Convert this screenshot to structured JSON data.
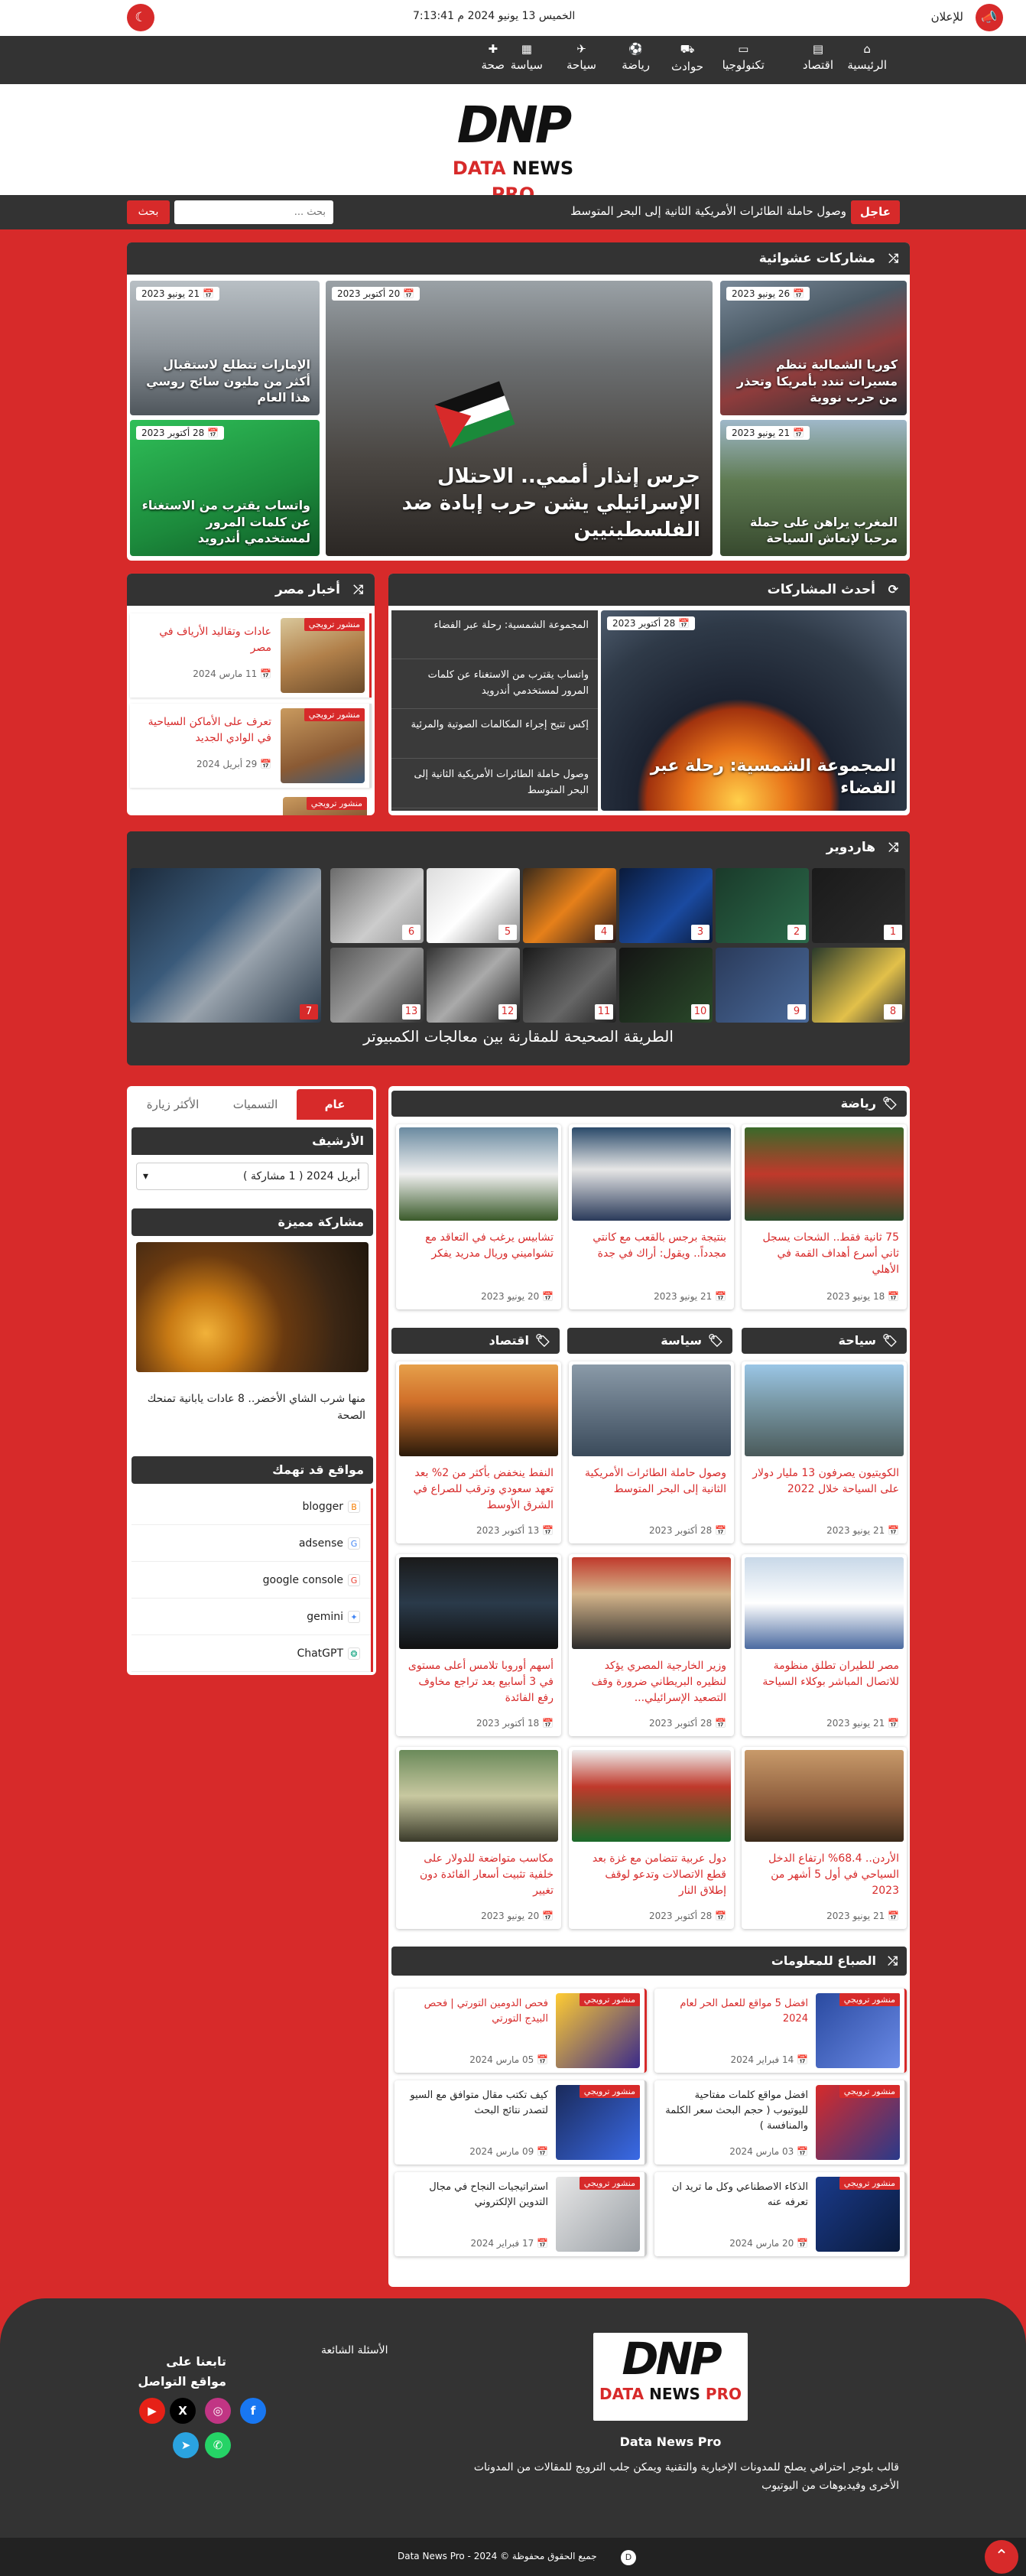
{
  "topbar": {
    "ads_label": "للإعلان",
    "datetime": "الخميس 13 يونيو 2024 م 7:13:41"
  },
  "nav": [
    {
      "label": "الرئيسية",
      "icon": "home-icon",
      "glyph": "⌂"
    },
    {
      "label": "اقتصاد",
      "icon": "chart-icon",
      "glyph": "▤"
    },
    {
      "label": "تكنولوجيا",
      "icon": "laptop-icon",
      "glyph": "▭"
    },
    {
      "label": "حوادث",
      "icon": "car-icon",
      "glyph": "⛟"
    },
    {
      "label": "رياضة",
      "icon": "football-icon",
      "glyph": "⚽"
    },
    {
      "label": "سياحة",
      "icon": "plane-icon",
      "glyph": "✈"
    },
    {
      "label": "سياسة",
      "icon": "newspaper-icon",
      "glyph": "▦"
    },
    {
      "label": "صحة",
      "icon": "health-icon",
      "glyph": "✚"
    }
  ],
  "logo": {
    "mark": "DNP",
    "text_parts": [
      "DATA ",
      "NEWS ",
      "PRO"
    ]
  },
  "breaking": {
    "label": "عاجل",
    "text": "وصول حاملة الطائرات الأمريكية الثانية إلى البحر المتوسط",
    "search_placeholder": "بحث ...",
    "search_button": "بحث"
  },
  "random": {
    "title": "مشاركات عشوائية",
    "main": {
      "date": "20 أكتوبر 2023",
      "title": "جرس إنذار أممي.. الاحتلال الإسرائيلي يشن حرب إبادة ضد الفلسطينيين"
    },
    "right": [
      {
        "date": "26 يونيو 2023",
        "title": "كوريا الشمالية تنظم مسيرات تندد بأمريكا وتحذر من حرب نووية"
      },
      {
        "date": "21 يونيو 2023",
        "title": "المغرب يراهن على حملة مرحبا لإنعاش السياحة"
      }
    ],
    "left": [
      {
        "date": "21 يونيو 2023",
        "title": "الإمارات تتطلع لاستقبال أكثر من مليون سائح روسي هذا العام"
      },
      {
        "date": "28 أكتوبر 2023",
        "title": "واتساب يقترب من الاستغناء عن كلمات المرور لمستخدمي أندرويد"
      }
    ]
  },
  "latest": {
    "title": "أحدث المشاركات",
    "feature": {
      "date": "28 أكتوبر 2023",
      "title": "المجموعة الشمسية: رحلة عبر الفضاء"
    },
    "items": [
      "المجموعة الشمسية: رحلة عبر الفضاء",
      "واتساب يقترب من الاستغناء عن كلمات المرور لمستخدمي أندرويد",
      "إكس تتيح إجراء المكالمات الصوتية والمرئية",
      "وصول حاملة الطائرات الأمريكية الثانية إلى البحر المتوسط"
    ]
  },
  "egypt": {
    "title": "أخبار مصر",
    "trend": "منشور ترويجي",
    "items": [
      {
        "title": "عادات وتقاليد الأرياف في مصر",
        "date": "11 مارس 2024"
      },
      {
        "title": "تعرف على الأماكن السياحية في الوادي الجديد",
        "date": "29 أبريل 2024"
      }
    ]
  },
  "hardware": {
    "title": "هاردوير",
    "caption": "الطريقة الصحيحة للمقارنة بين معالجات الكمبيوتر",
    "numbers": [
      "1",
      "2",
      "3",
      "4",
      "5",
      "6",
      "7",
      "8",
      "9",
      "10",
      "11",
      "12",
      "13"
    ]
  },
  "tabs": {
    "items": [
      "عام",
      "التسميات",
      "الأكثر زيارة"
    ]
  },
  "archive": {
    "title": "الأرشيف",
    "selected": "أبريل 2024 ( 1 مشاركة )"
  },
  "featured": {
    "title": "مشاركة مميزة",
    "post_title": "منها شرب الشاي الأخضر.. 8 عادات يابانية تمنحك الصحة"
  },
  "sites": {
    "title": "مواقع قد تهمك",
    "items": [
      {
        "name": "blogger",
        "icon": "blogger-icon",
        "glyph": "B",
        "color": "#f57d00"
      },
      {
        "name": "adsense",
        "icon": "adsense-icon",
        "glyph": "G",
        "color": "#4285f4"
      },
      {
        "name": "google console",
        "icon": "google-icon",
        "glyph": "G",
        "color": "#ea4335"
      },
      {
        "name": "gemini",
        "icon": "gemini-icon",
        "glyph": "✦",
        "color": "#4285f4"
      },
      {
        "name": "ChatGPT",
        "icon": "chatgpt-icon",
        "glyph": "❂",
        "color": "#10a37f"
      }
    ]
  },
  "sports": {
    "title": "رياضة",
    "items": [
      {
        "title": "75 ثانية فقط.. الشحات يسجل ثاني أسرع أهداف القمة في الأهلي",
        "date": "18 يونيو 2023"
      },
      {
        "title": "بنتيجة برجس بالقعب مع كانتي مجدداً.. ويقول: أراك في جدة",
        "date": "21 يونيو 2023"
      },
      {
        "title": "تشابيس يرغب في التعاقد مع تشواميني وريال مدريد يفكر",
        "date": "20 يونيو 2023"
      }
    ]
  },
  "cat_titles": {
    "tourism": "سياحة",
    "politics": "سياسة",
    "economy": "اقتصاد"
  },
  "grid": [
    [
      {
        "title": "الكويتيون يصرفون 13 مليار دولار على السياحة خلال 2022",
        "date": "21 يونيو 2023"
      },
      {
        "title": "وصول حاملة الطائرات الأمريكية الثانية إلى البحر المتوسط",
        "date": "28 أكتوبر 2023"
      },
      {
        "title": "النفط ينخفض بأكثر من 2% بعد تعهد سعودي وترقب للصراع في الشرق الأوسط",
        "date": "13 أكتوبر 2023"
      }
    ],
    [
      {
        "title": "مصر للطيران تطلق منظومة للاتصال المباشر بوكلاء السياحة",
        "date": "21 يونيو 2023"
      },
      {
        "title": "وزير الخارجية المصري يؤكد لنظيره البريطاني ضرورة وقف التصعيد الإسرائيلي...",
        "date": "28 أكتوبر 2023"
      },
      {
        "title": "أسهم أوروبا تلامس أعلى مستوى في 3 أسابيع بعد تراجع مخاوف رفع الفائدة",
        "date": "18 أكتوبر 2023"
      }
    ],
    [
      {
        "title": "الأردن.. 68.4% ارتفاع الدخل السياحي في أول 5 أشهر من 2023",
        "date": "21 يونيو 2023"
      },
      {
        "title": "دول عربية تتضامن مع غزة بعد قطع الاتصالات وتدعو لوقف إطلاق النار",
        "date": "28 أكتوبر 2023"
      },
      {
        "title": "مكاسب متواضعة للدولار على خلفية تثبيت أسعار الفائدة دون تغيير",
        "date": "20 يونيو 2023"
      }
    ]
  ],
  "info": {
    "title": "الصباع للمعلومات",
    "trend": "منشور ترويجي",
    "items": [
      {
        "title": "افضل 5 مواقع للعمل الحر لعام 2024",
        "date": "14 فبراير 2024",
        "red": true
      },
      {
        "title": "فحص الدومين التورتي | فحص البيدج التورتي",
        "date": "05 مارس 2024",
        "red": true
      },
      {
        "title": "افضل مواقع كلمات مفتاحية لليوتيوب ( حجم البحث سعر الكلمة والمنافسة )",
        "date": "03 مارس 2024",
        "red": false
      },
      {
        "title": "كيف تكتب مقال متوافق مع السيو لتصدر نتائج البحث",
        "date": "09 مارس 2024",
        "red": false
      },
      {
        "title": "الذكاء الاصطناعي وكل ما تريد ان تعرفه عنه",
        "date": "20 مارس 2024",
        "red": false
      },
      {
        "title": "استراتيجيات النجاح في مجال التدوين الإلكتروني",
        "date": "17 فبراير 2024",
        "red": false
      }
    ]
  },
  "footer": {
    "site_name": "Data News Pro",
    "about": "قالب بلوجر احترافي يصلح للمدونات الإخبارية والتقنية ويمكن جلب الترويج للمقالات من المدونات الأخرى وفيديوهات من اليوتيوب",
    "faq": "الأسئلة الشائعة",
    "follow": "تابعنا على مواقع التواصل",
    "copyright": "جميع الحقوق محفوظة © Data News Pro - 2024"
  },
  "colors": {
    "accent": "#d72a2a",
    "dark": "#333333"
  }
}
